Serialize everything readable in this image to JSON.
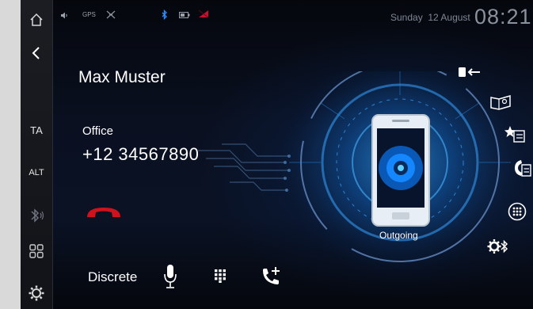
{
  "status": {
    "gps_label": "GPS",
    "day": "Sunday",
    "date": "12 August",
    "time": "08:21"
  },
  "sidebar": {
    "ta_label": "TA",
    "alt_label": "ALT"
  },
  "call": {
    "contact_name": "Max Muster",
    "number_label": "Office",
    "phone_number": "+12 34567890",
    "state": "Outgoing"
  },
  "bottom": {
    "discrete_label": "Discrete"
  },
  "colors": {
    "hangup": "#d0121c",
    "glow": "#1e90ff",
    "accent_red": "#c8102e"
  }
}
